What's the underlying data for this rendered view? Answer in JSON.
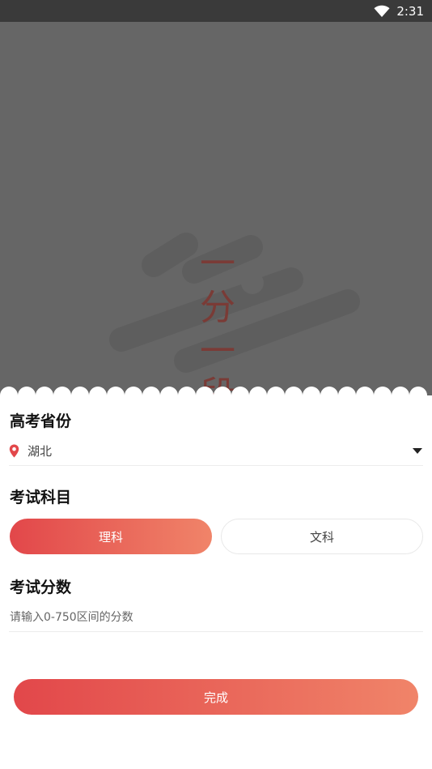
{
  "status_bar": {
    "time": "2:31",
    "icons": [
      "wifi-icon"
    ]
  },
  "hero": {
    "title": "一分一段"
  },
  "province": {
    "heading": "高考省份",
    "selected": "湖北",
    "icons": [
      "location-pin-icon",
      "dropdown-caret-icon"
    ]
  },
  "subject": {
    "heading": "考试科目",
    "options": [
      "理科",
      "文科"
    ],
    "selected": "理科"
  },
  "score": {
    "heading": "考试分数",
    "placeholder": "请输入0-750区间的分数",
    "value": ""
  },
  "submit": {
    "label": "完成"
  },
  "colors": {
    "accent_start": "#e2474a",
    "accent_end": "#f08469",
    "hero_overlay": "#666666",
    "status_bar": "#3a3a3a",
    "pin": "#e2474a"
  }
}
